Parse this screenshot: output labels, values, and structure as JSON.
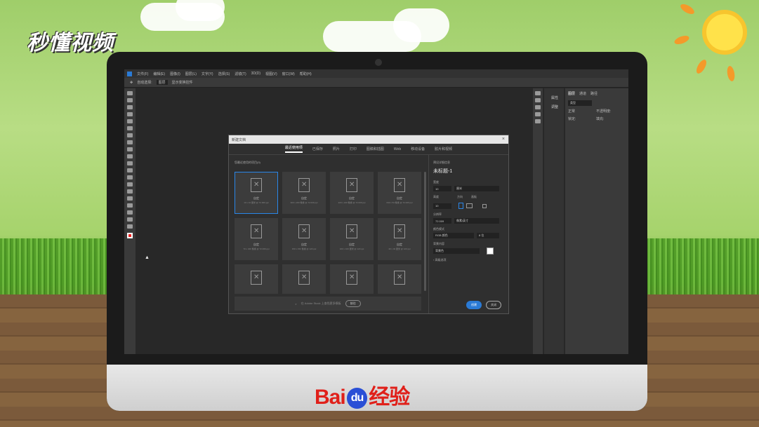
{
  "watermark_top": "秒懂视频",
  "brand_bottom": {
    "baidu": "Bai",
    "du": "du",
    "jingyan": "经验"
  },
  "menubar": [
    "文件(F)",
    "编辑(E)",
    "图像(I)",
    "图层(L)",
    "文字(Y)",
    "选择(S)",
    "滤镜(T)",
    "3D(D)",
    "视图(V)",
    "窗口(W)",
    "帮助(H)"
  ],
  "options": {
    "auto_select": "自动选择:",
    "layer": "图层",
    "show_transform": "显示变换控件"
  },
  "right_panel": {
    "item1": "属性",
    "item2": "调整",
    "tabs": [
      "图层",
      "通道",
      "路径"
    ],
    "kind": "类型",
    "normal": "正常",
    "opacity": "不透明度:",
    "lock": "锁定:",
    "fill": "填充:"
  },
  "dialog": {
    "title": "新建文档",
    "tabs": [
      "最近使用项",
      "已保存",
      "照片",
      "打印",
      "图稿和插图",
      "Web",
      "移动设备",
      "胶片和视频"
    ],
    "recent_label": "您最近使用的项目(9)",
    "cards": [
      {
        "name": "自定",
        "desc": "10 x 10 厘米 @ 72.009 ppi"
      },
      {
        "name": "自定",
        "desc": "300 x 200 像素 @ 72.009 ppi"
      },
      {
        "name": "自定",
        "desc": "220 x 220 像素 @ 72.009 ppi"
      },
      {
        "name": "自定",
        "desc": "640 x 54 像素 @ 72.009 ppi"
      },
      {
        "name": "自定",
        "desc": "70 x 400 像素 @ 72.009 ppi"
      },
      {
        "name": "自定",
        "desc": "150 x 150 像素 @ 120 ppi"
      },
      {
        "name": "自定",
        "desc": "100 x 100 厘米 @ 120 ppi"
      },
      {
        "name": "自定",
        "desc": "40 x 40 厘米 @ 120 ppi"
      },
      {
        "name": "",
        "desc": ""
      },
      {
        "name": "",
        "desc": ""
      },
      {
        "name": "",
        "desc": ""
      },
      {
        "name": "",
        "desc": ""
      }
    ],
    "search_placeholder": "在 Adobe Stock 上查找更多模板",
    "goto": "前往",
    "preset_details": "预设详细信息",
    "doc_name": "未标题-1",
    "width_label": "宽度",
    "width_value": "10",
    "unit": "厘米",
    "height_label": "高度",
    "height_value": "10",
    "orientation_label": "方向",
    "artboard_label": "画板",
    "resolution_label": "分辨率",
    "resolution_value": "72.009",
    "resolution_unit": "像素/英寸",
    "color_mode_label": "颜色模式",
    "color_mode": "RGB 颜色",
    "bit_depth": "8 位",
    "background_label": "背景内容",
    "background": "背景色",
    "advanced": "高级选项",
    "create": "创建",
    "close": "关闭"
  }
}
